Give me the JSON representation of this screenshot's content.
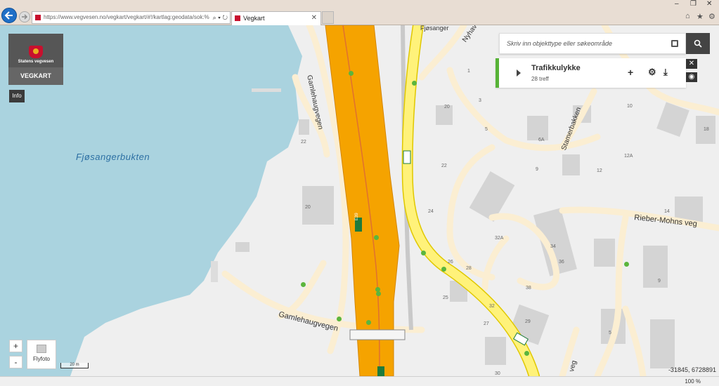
{
  "browser": {
    "url": "https://www.vegvesen.no/vegkart/vegkart/#!/kartlag:geodata/sok:%",
    "tab_title": "Vegkart",
    "zoom_level": "100 %"
  },
  "app": {
    "logo_text": "Statens vegvesen",
    "title": "VEGKART",
    "info_label": "Info"
  },
  "search": {
    "placeholder": "Skriv inn objekttype eller søkeområde"
  },
  "layer_panel": {
    "name": "Trafikkulykke",
    "count": "28 treff",
    "accent_color": "#57b337"
  },
  "map_controls": {
    "zoom_in": "+",
    "zoom_out": "-",
    "flyfoto": "Flyfoto",
    "scale": "20 m",
    "coordinates": "-31845, 6728891"
  },
  "map_labels": {
    "bay": "Fjøsangerbukten",
    "gamlehaugvegen": "Gamlehaugvegen",
    "gamlehaugvegen2": "Gamlehaugvegen",
    "fjosanger": "Fjøsanger",
    "nyhavn": "Nyhav",
    "stamerbakken": "Stamerbakken",
    "rieber": "Rieber-Mohns veg",
    "veg": "veg",
    "e39": "E39",
    "house_numbers": [
      "1",
      "3",
      "5",
      "6A",
      "9",
      "10",
      "12",
      "12A",
      "14",
      "18",
      "20",
      "20",
      "22",
      "22",
      "24",
      "25",
      "26",
      "27",
      "28",
      "29",
      "30",
      "32",
      "32A",
      "34",
      "36",
      "38",
      "5",
      "9"
    ]
  },
  "colors": {
    "water": "#aad3df",
    "land": "#efefef",
    "motorway": "#f5a300",
    "main_road": "#fff27a",
    "local_road": "#fbeed2",
    "building": "#d4d4d4",
    "accident_point": "#5bb53d"
  }
}
